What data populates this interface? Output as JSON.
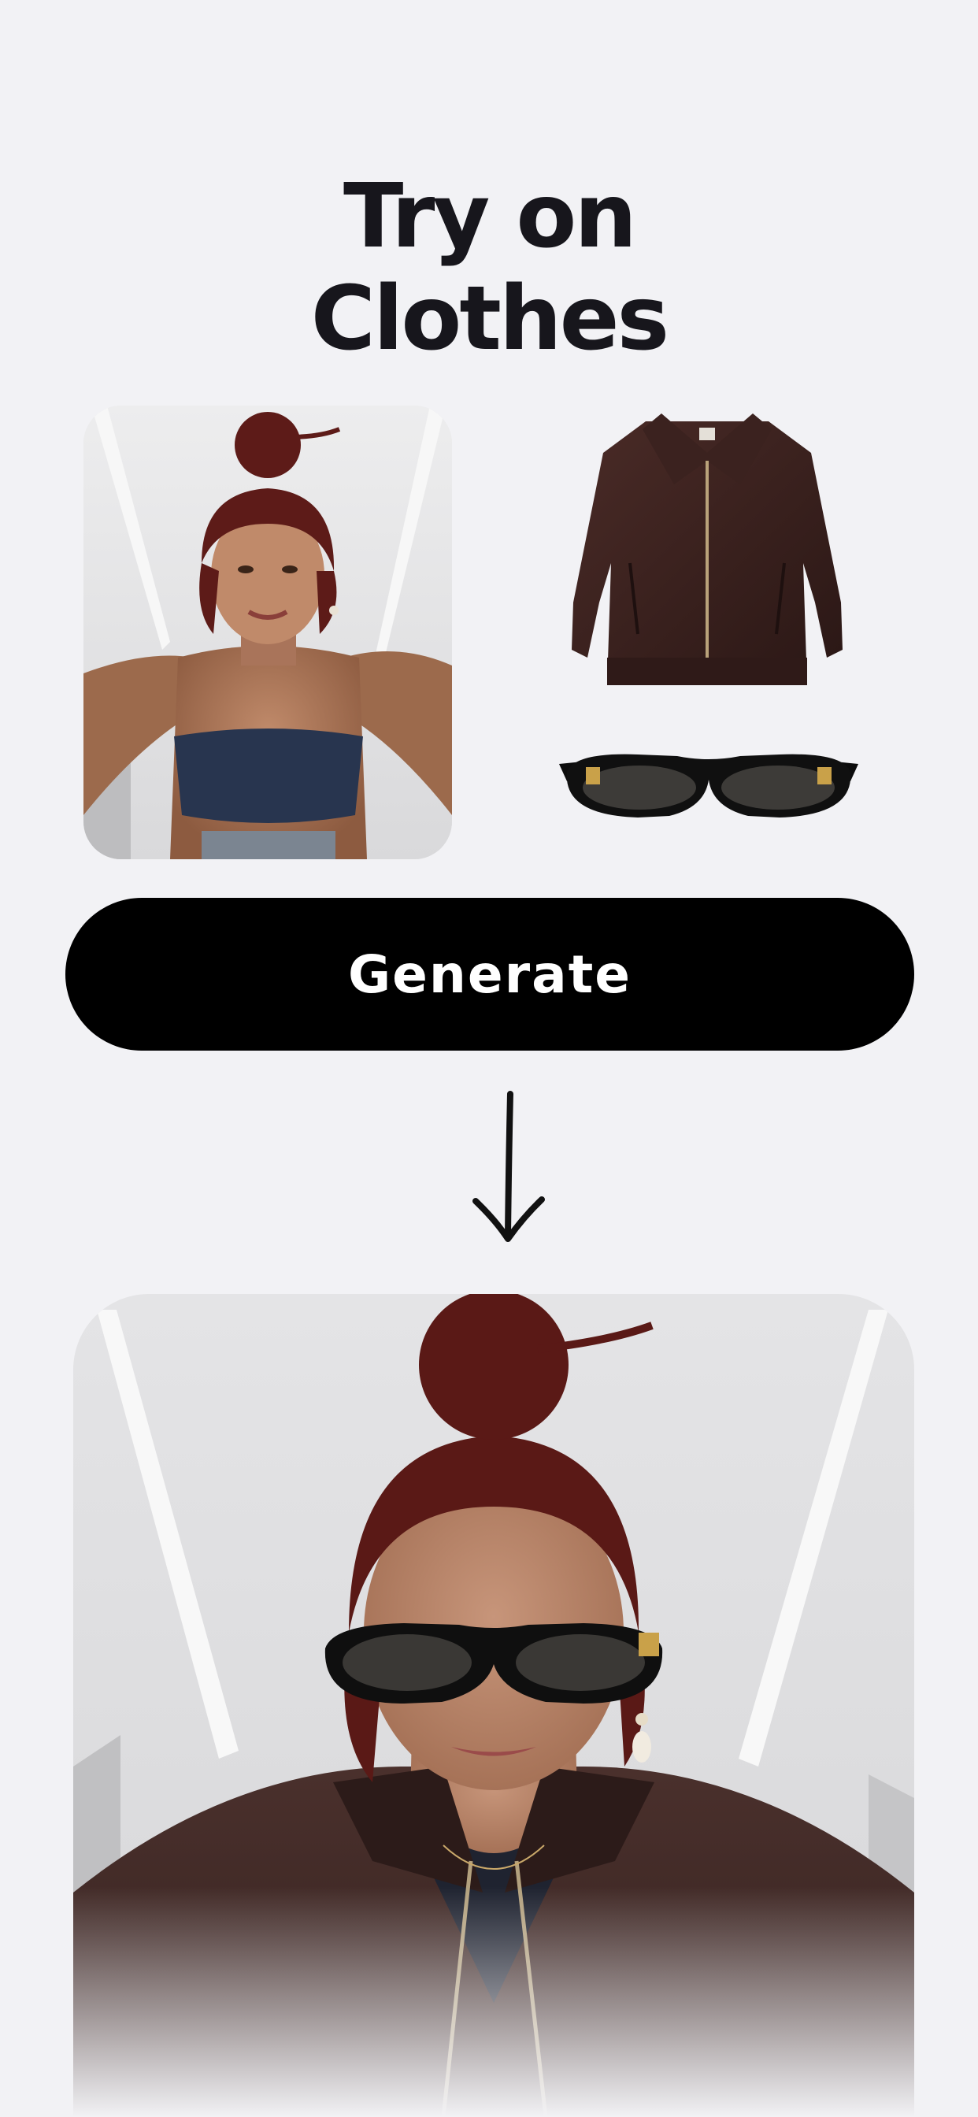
{
  "header": {
    "title_line1": "Try on",
    "title_line2": "Clothes"
  },
  "inputs": {
    "person_photo": "person-photo",
    "items": [
      "leather-jacket",
      "sunglasses"
    ]
  },
  "actions": {
    "generate_label": "Generate"
  },
  "colors": {
    "background": "#f2f2f5",
    "title": "#17161c",
    "button_bg": "#000000",
    "button_text": "#ffffff",
    "jacket": "#3a2320",
    "hair": "#6b1f1c"
  }
}
